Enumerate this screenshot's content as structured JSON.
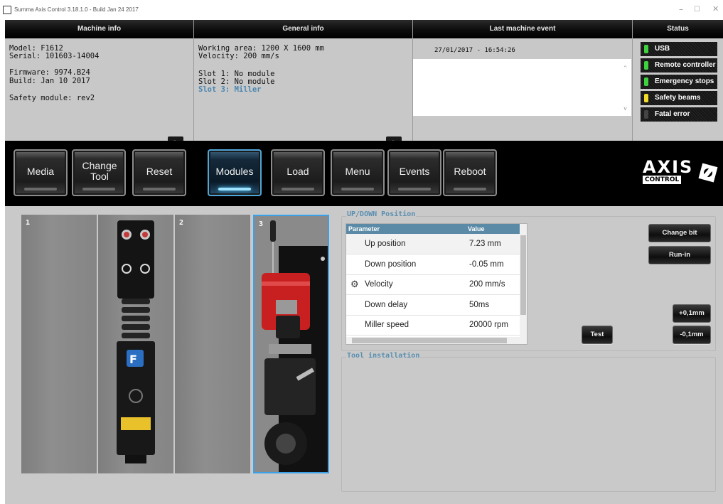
{
  "window": {
    "title": "Summa Axis Control 3.18.1.0 - Build Jan 24 2017",
    "minimize": "–",
    "maximize": "☐",
    "close": "✕"
  },
  "machine_info": {
    "header": "Machine info",
    "model": "Model: F1612",
    "serial": "Serial: 101603-14004",
    "firmware": "Firmware: 9974.B24",
    "build": "Build: Jan 10 2017",
    "safety": "Safety module: rev2"
  },
  "general_info": {
    "header": "General info",
    "working_area": "Working area: 1200 X 1600 mm",
    "velocity": "Velocity: 200 mm/s",
    "slot1": "Slot 1: No module",
    "slot2": "Slot 2: No module",
    "slot3": "Slot 3: Miller"
  },
  "last_event": {
    "header": "Last machine event",
    "timestamp": "27/01/2017 - 16:54:26"
  },
  "status": {
    "header": "Status",
    "items": [
      {
        "label": "USB",
        "color": "#3fd23f"
      },
      {
        "label": "Remote controller",
        "color": "#3fd23f"
      },
      {
        "label": "Emergency stops",
        "color": "#3fd23f"
      },
      {
        "label": "Safety beams",
        "color": "#f2dc2a"
      },
      {
        "label": "Fatal error",
        "color": "#444444"
      }
    ]
  },
  "toolbar": {
    "buttons": [
      {
        "label": "Media"
      },
      {
        "label": "Change Tool"
      },
      {
        "label": "Reset"
      },
      {
        "label": "Modules",
        "active": true
      },
      {
        "label": "Load"
      },
      {
        "label": "Menu"
      },
      {
        "label": "Events"
      },
      {
        "label": "Reboot"
      }
    ],
    "logo_top": "AXIS",
    "logo_bottom": "CONTROL"
  },
  "slots": [
    "1",
    "",
    "2",
    "3"
  ],
  "updown": {
    "title": "UP/DOWN Position",
    "columns": [
      "Parameter",
      "Value"
    ],
    "rows": [
      {
        "param": "Up position",
        "value": "7.23 mm"
      },
      {
        "param": "Down position",
        "value": "-0.05 mm"
      },
      {
        "param": "Velocity",
        "value": "200 mm/s"
      },
      {
        "param": "Down delay",
        "value": "50ms"
      },
      {
        "param": "Miller speed",
        "value": "20000 rpm"
      }
    ],
    "change_bit": "Change bit",
    "run_in": "Run-in",
    "test": "Test",
    "plus": "+0,1mm",
    "minus": "-0,1mm"
  },
  "tool_installation": {
    "title": "Tool installation"
  }
}
